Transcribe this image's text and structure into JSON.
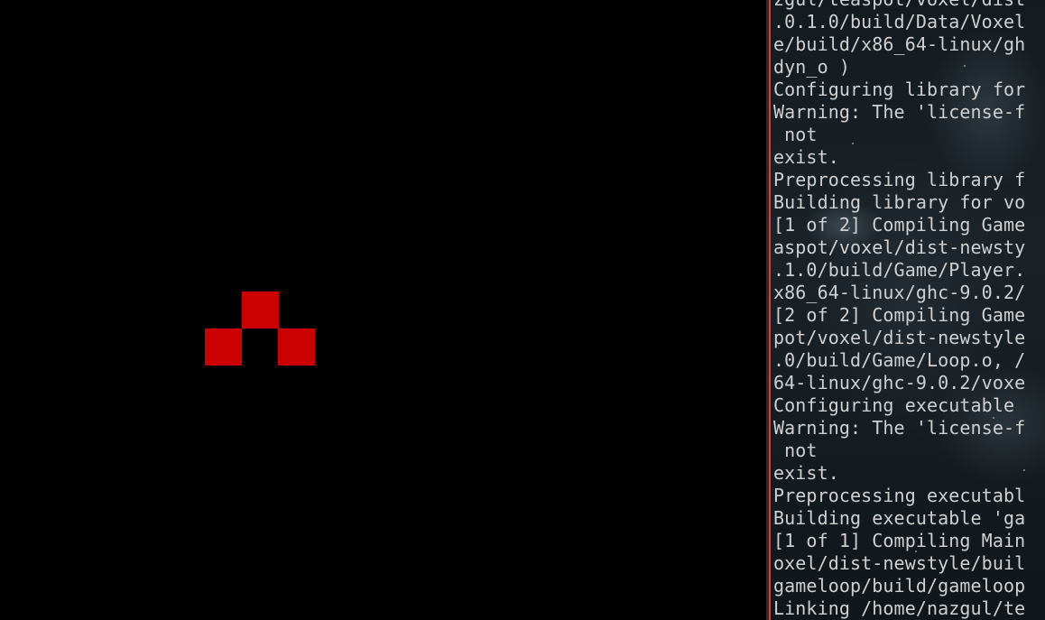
{
  "colors": {
    "block": "#cc0000",
    "terminal_text": "#d0d0d0",
    "window_border": "#e03b3b",
    "game_background": "#000000"
  },
  "terminal": {
    "lines": [
      "zgul/teaspot/voxel/dist",
      ".0.1.0/build/Data/Voxel",
      "e/build/x86_64-linux/gh",
      "dyn_o )",
      "Configuring library for",
      "Warning: The 'license-f",
      " not",
      "exist.",
      "Preprocessing library f",
      "Building library for vo",
      "[1 of 2] Compiling Game",
      "aspot/voxel/dist-newsty",
      ".1.0/build/Game/Player.",
      "x86_64-linux/ghc-9.0.2/",
      "[2 of 2] Compiling Game",
      "pot/voxel/dist-newstyle",
      ".0/build/Game/Loop.o, /",
      "64-linux/ghc-9.0.2/voxe",
      "Configuring executable ",
      "Warning: The 'license-f",
      " not",
      "exist.",
      "Preprocessing executabl",
      "Building executable 'ga",
      "[1 of 1] Compiling Main",
      "oxel/dist-newstyle/buil",
      "gameloop/build/gameloop",
      "Linking /home/nazgul/te"
    ]
  }
}
